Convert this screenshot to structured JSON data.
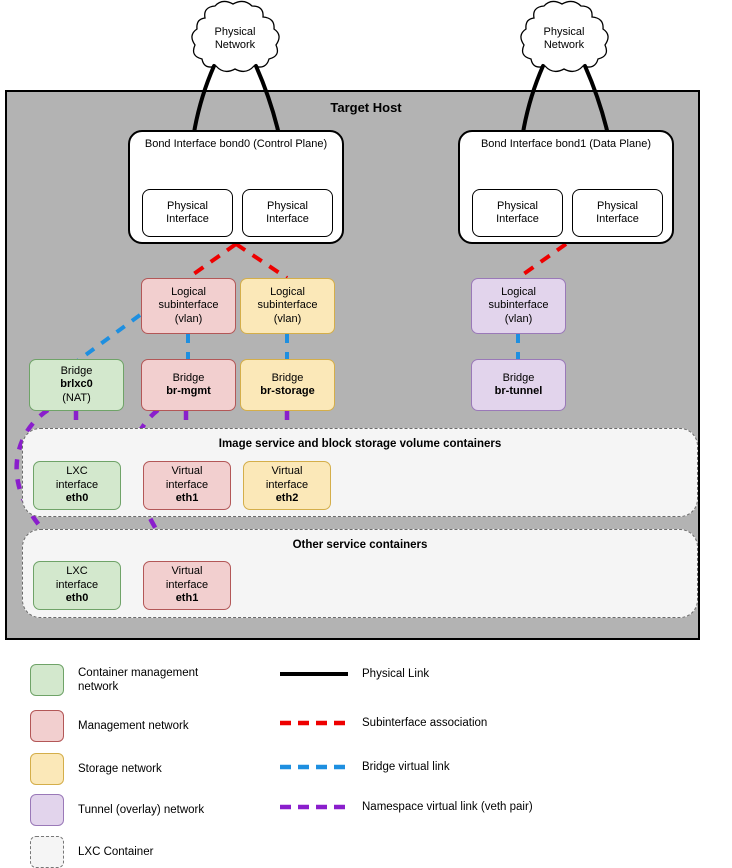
{
  "diagram": {
    "title": "Target Host",
    "host_panel_color": "#b3b3b3"
  },
  "clouds": [
    {
      "id": "cloud-left",
      "line1": "Physical",
      "line2": "Network"
    },
    {
      "id": "cloud-right",
      "line1": "Physical",
      "line2": "Network"
    }
  ],
  "bonds": [
    {
      "id": "bond0",
      "title": "Bond Interface",
      "name": "bond0",
      "role": "(Control Plane)",
      "interfaces": [
        {
          "line1": "Physical",
          "line2": "Interface"
        },
        {
          "line1": "Physical",
          "line2": "Interface"
        }
      ]
    },
    {
      "id": "bond1",
      "title": "Bond Interface",
      "name": "bond1",
      "role": "(Data Plane)",
      "interfaces": [
        {
          "line1": "Physical",
          "line2": "Interface"
        },
        {
          "line1": "Physical",
          "line2": "Interface"
        }
      ]
    }
  ],
  "subinterfaces": [
    {
      "id": "subif-mgmt",
      "line1": "Logical",
      "line2": "subinterface",
      "line3": "(vlan)",
      "fill": "#f2cfcf",
      "stroke": "#b35757"
    },
    {
      "id": "subif-storage",
      "line1": "Logical",
      "line2": "subinterface",
      "line3": "(vlan)",
      "fill": "#fbe8b8",
      "stroke": "#d4ae4a"
    },
    {
      "id": "subif-tunnel",
      "line1": "Logical",
      "line2": "subinterface",
      "line3": "(vlan)",
      "fill": "#e2d4ec",
      "stroke": "#9a79b8"
    }
  ],
  "bridges": [
    {
      "id": "bridge-brlxc0",
      "line1": "Bridge",
      "name": "brlxc0",
      "line3": "(NAT)",
      "fill": "#d3e8cd",
      "stroke": "#6fa368"
    },
    {
      "id": "bridge-br-mgmt",
      "line1": "Bridge",
      "name": "br-mgmt",
      "line3": "",
      "fill": "#f2cfcf",
      "stroke": "#b35757"
    },
    {
      "id": "bridge-br-storage",
      "line1": "Bridge",
      "name": "br-storage",
      "line3": "",
      "fill": "#fbe8b8",
      "stroke": "#d4ae4a"
    },
    {
      "id": "bridge-br-tunnel",
      "line1": "Bridge",
      "name": "br-tunnel",
      "line3": "",
      "fill": "#e2d4ec",
      "stroke": "#9a79b8"
    }
  ],
  "container_groups": [
    {
      "id": "group-image-storage",
      "title": "Image service and block storage volume containers",
      "interfaces": [
        {
          "id": "if-eth0-a",
          "line1": "LXC",
          "line2": "interface",
          "name": "eth0",
          "fill": "#d3e8cd",
          "stroke": "#6fa368"
        },
        {
          "id": "if-eth1-a",
          "line1": "Virtual",
          "line2": "interface",
          "name": "eth1",
          "fill": "#f2cfcf",
          "stroke": "#b35757"
        },
        {
          "id": "if-eth2-a",
          "line1": "Virtual",
          "line2": "interface",
          "name": "eth2",
          "fill": "#fbe8b8",
          "stroke": "#d4ae4a"
        }
      ]
    },
    {
      "id": "group-other-services",
      "title": "Other service containers",
      "interfaces": [
        {
          "id": "if-eth0-b",
          "line1": "LXC",
          "line2": "interface",
          "name": "eth0",
          "fill": "#d3e8cd",
          "stroke": "#6fa368"
        },
        {
          "id": "if-eth1-b",
          "line1": "Virtual",
          "line2": "interface",
          "name": "eth1",
          "fill": "#f2cfcf",
          "stroke": "#b35757"
        }
      ]
    }
  ],
  "legend": {
    "swatches": [
      {
        "id": "legend-container-mgmt",
        "label": "Container management\nnetwork",
        "fill": "#d3e8cd",
        "stroke": "#6fa368",
        "dashed": false
      },
      {
        "id": "legend-management",
        "label": "Management network",
        "fill": "#f2cfcf",
        "stroke": "#b35757",
        "dashed": false
      },
      {
        "id": "legend-storage",
        "label": "Storage network",
        "fill": "#fbe8b8",
        "stroke": "#d4ae4a",
        "dashed": false
      },
      {
        "id": "legend-tunnel",
        "label": "Tunnel (overlay) network",
        "fill": "#e2d4ec",
        "stroke": "#9a79b8",
        "dashed": false
      },
      {
        "id": "legend-lxc-container",
        "label": "LXC Container",
        "fill": "#f5f5f5",
        "stroke": "#777777",
        "dashed": true
      }
    ],
    "lines": [
      {
        "id": "legend-physical-link",
        "label": "Physical Link",
        "color": "#000000",
        "dashed": false
      },
      {
        "id": "legend-subif-assoc",
        "label": "Subinterface association",
        "color": "#ee0000",
        "dashed": true
      },
      {
        "id": "legend-bridge-link",
        "label": "Bridge virtual link",
        "color": "#1e8fe0",
        "dashed": true
      },
      {
        "id": "legend-namespace-link",
        "label": "Namespace virtual link (veth pair)",
        "color": "#8a1ecc",
        "dashed": true
      }
    ]
  },
  "colors": {
    "physical_link": "#000000",
    "subinterface_association": "#ee0000",
    "bridge_virtual_link": "#1e8fe0",
    "namespace_virtual_link": "#8a1ecc",
    "host_background": "#b3b3b3",
    "container_background": "#f5f5f5"
  }
}
